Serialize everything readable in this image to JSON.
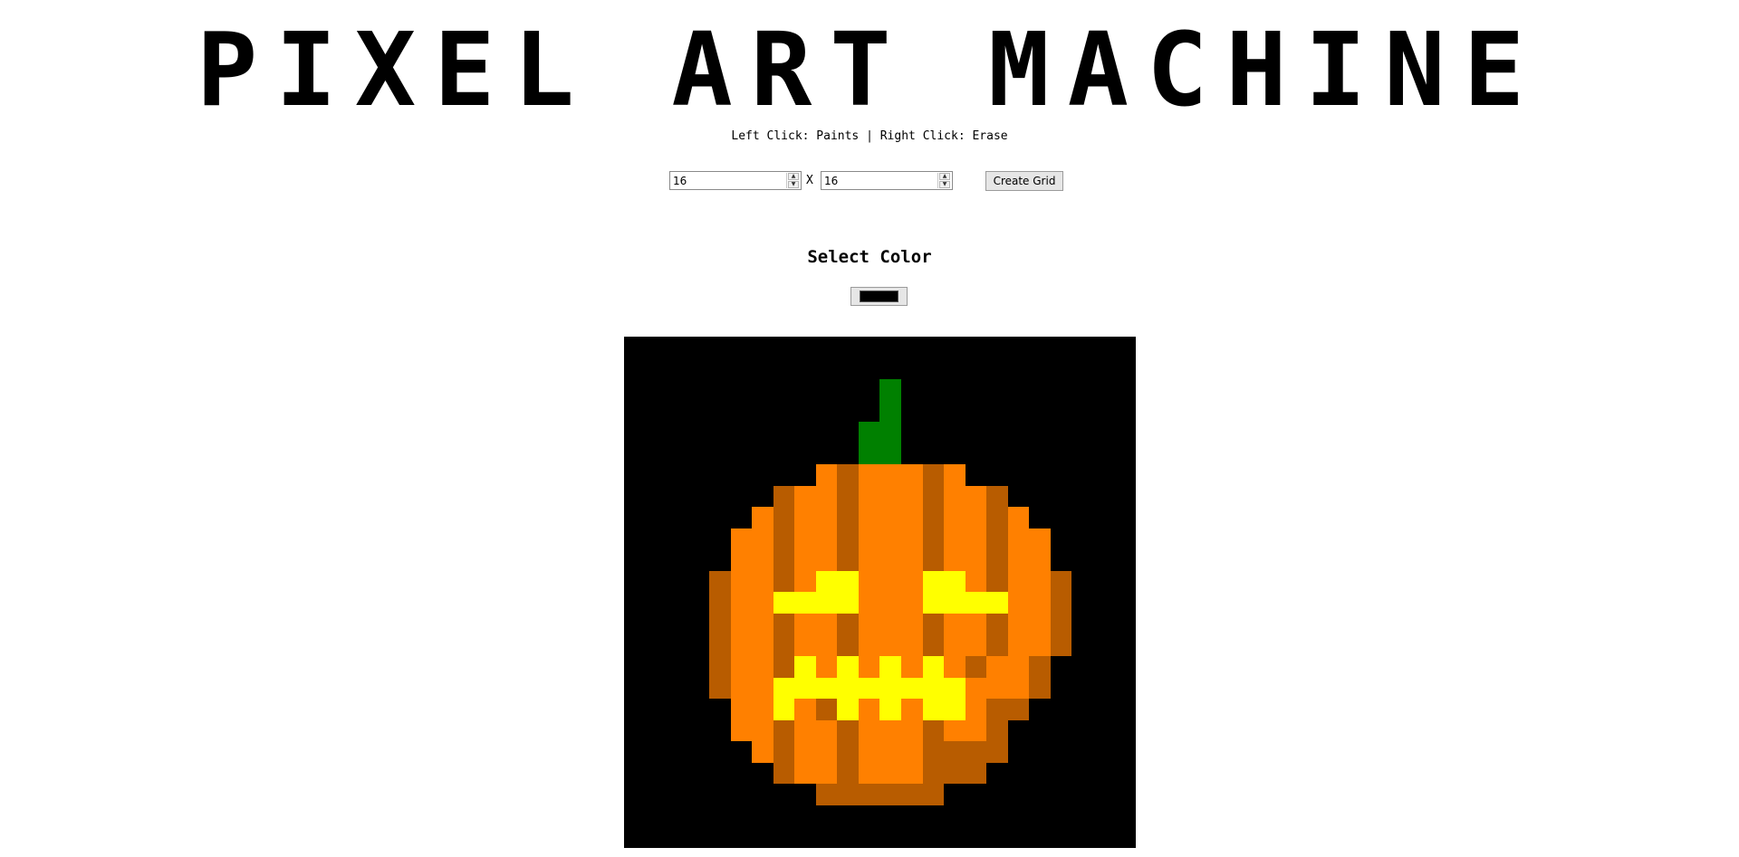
{
  "header": {
    "title": "PIXEL ART MACHINE",
    "instructions": "Left Click: Paints | Right Click: Erase"
  },
  "grid_controls": {
    "height_value": "16",
    "times_label": "X",
    "width_value": "16",
    "create_button_label": "Create Grid"
  },
  "color_section": {
    "label": "Select Color",
    "selected_color": "#000000"
  },
  "palette": {
    "K": "#000000",
    "O": "#ff8000",
    "D": "#b85c00",
    "Y": "#ffff00",
    "G": "#008000"
  },
  "canvas": {
    "background": "#000000",
    "rows": [
      "KKKKKKKKKKKKKKKKKKKKKKKK",
      "KKKKKKKKKKKKKKKKKKKKKKKK",
      "KKKKKKKKKKKKGKKKKKKKKKKK",
      "KKKKKKKKKKKKGKKKKKKKKKKK",
      "KKKKKKKKKKKGGKKKKKKKKKKK",
      "KKKKKKKKKKKGGKKKKKKKKKKK",
      "KKKKKKKKKODOOODOKKKKKKKK",
      "KKKKKKKDOODOOODOODKKKKKK",
      "KKKKKKODOODOOODOODOKKKKK",
      "KKKKKOODOODOOODOODOOKKKK",
      "KKKKKOODOODOOODOODOOKKKK",
      "KKKKDOODOYYOOOYYODOODKKK",
      "KKKKDOOYYYYOOOYYYYOODKKK",
      "KKKKDOODOODOOODOODOODKKK",
      "KKKKDOODOODOOODOODOODKKK",
      "KKKKDOODYOYOYOYODOODKKKK",
      "KKKKDOOYYYYYYYYYOOODKKKK",
      "KKKKKOOYODYOYOYYODDKKKKK",
      "KKKKKOODOODOOODOODKKKKKK",
      "KKKKKKODOODOOODDDDKKKKKK",
      "KKKKKKKDOODOOODDDKKKKKKK",
      "KKKKKKKKKDDDDDDKKKKKKKKK",
      "KKKKKKKKKKKKKKKKKKKKKKKK",
      "KKKKKKKKKKKKKKKKKKKKKKKK"
    ]
  }
}
